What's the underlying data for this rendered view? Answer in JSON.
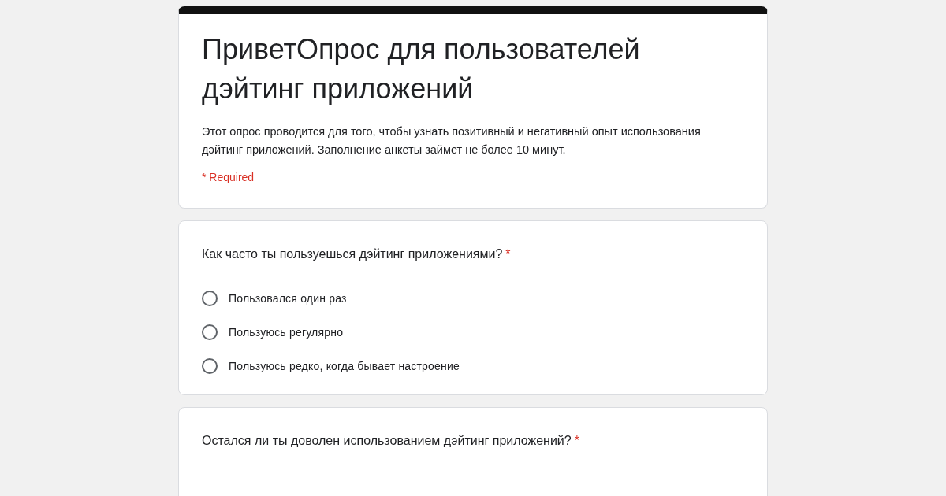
{
  "form": {
    "title": "ПриветОпрос для пользователей дэйтинг приложений",
    "description": "Этот опрос проводится для того, чтобы узнать позитивный и негативный опыт использования дэйтинг приложений. Заполнение анкеты займет не более 10 минут.",
    "required_note": "* Required"
  },
  "questions": [
    {
      "text": "Как часто ты пользуешься дэйтинг приложениями?",
      "required_mark": "*",
      "options": [
        {
          "label": "Пользовался один раз",
          "selected": false
        },
        {
          "label": "Пользуюсь регулярно",
          "selected": false
        },
        {
          "label": "Пользуюсь редко, когда бывает настроение",
          "selected": false
        }
      ]
    },
    {
      "text": "Остался ли ты доволен использованием дэйтинг приложений?",
      "required_mark": "*"
    }
  ]
}
